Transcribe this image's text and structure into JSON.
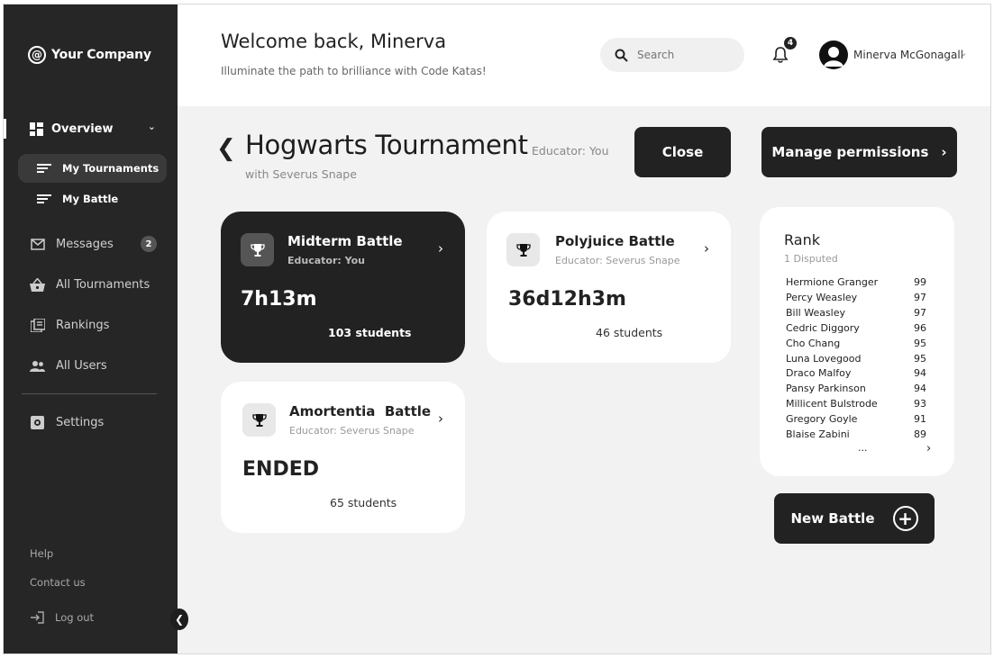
{
  "sidebar": {
    "company": "Your Company",
    "logo_glyph": "@",
    "overview": "Overview",
    "sub_items": [
      "My Tournaments",
      "My Battle"
    ],
    "messages": "Messages",
    "messages_count": "2",
    "all_tournaments": "All Tournaments",
    "rankings": "Rankings",
    "all_users": "All Users",
    "settings": "Settings",
    "help": "Help",
    "contact": "Contact us",
    "logout": "Log out"
  },
  "header": {
    "welcome": "Welcome back, Minerva",
    "subtitle": "Illuminate the path to brilliance with Code Katas!",
    "search_placeholder": "Search",
    "notifications_count": "4",
    "user_name": "Minerva McGonagall"
  },
  "tournament": {
    "title": "Hogwarts Tournament",
    "educator": "Educator: You",
    "with": "with Severus Snape",
    "close_label": "Close",
    "manage_label": "Manage permissions"
  },
  "battles": [
    {
      "name": "Midterm Battle",
      "educator": "Educator: You",
      "time": "7h13m",
      "students": "103 students"
    },
    {
      "name": "Polyjuice Battle",
      "educator": "Educator: Severus Snape",
      "time": "36d12h3m",
      "students": "46 students"
    },
    {
      "name": "Amortentia  Battle",
      "educator": "Educator: Severus Snape",
      "time": "ENDED",
      "students": "65 students"
    }
  ],
  "rank": {
    "title": "Rank",
    "subtitle": "1 Disputed",
    "rows": [
      {
        "name": "Hermione Granger",
        "score": "99"
      },
      {
        "name": "Percy Weasley",
        "score": "97"
      },
      {
        "name": "Bill Weasley",
        "score": "97"
      },
      {
        "name": "Cedric Diggory",
        "score": "96"
      },
      {
        "name": "Cho Chang",
        "score": "95"
      },
      {
        "name": "Luna Lovegood",
        "score": "95"
      },
      {
        "name": "Draco Malfoy",
        "score": "94"
      },
      {
        "name": "Pansy Parkinson",
        "score": "94"
      },
      {
        "name": "Millicent Bulstrode",
        "score": "93"
      },
      {
        "name": "Gregory Goyle",
        "score": "91"
      },
      {
        "name": "Blaise Zabini",
        "score": "89"
      }
    ],
    "more": "..."
  },
  "new_battle_label": "New Battle"
}
